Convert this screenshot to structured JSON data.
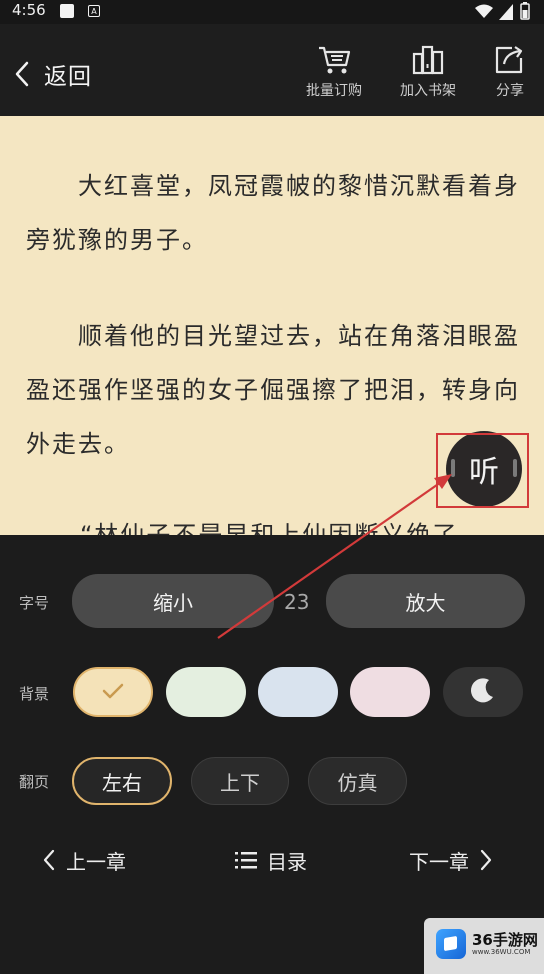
{
  "status_bar": {
    "time": "4:56",
    "notif_icon_text": "A"
  },
  "toolbar": {
    "back_label": "返回",
    "bulk_buy_label": "批量订购",
    "add_shelf_label": "加入书架",
    "share_label": "分享"
  },
  "reader": {
    "paragraphs": [
      "　　大红喜堂，凤冠霞帔的黎惜沉默看着身旁犹豫的男子。",
      "　　顺着他的目光望过去，站在角落泪眼盈盈还强作坚强的女子倔强擦了把泪，转身向外走去。",
      "“林仙子不是早和上仙因断义绝了"
    ],
    "listen_label": "听"
  },
  "settings": {
    "font_size": {
      "label": "字号",
      "decrease": "缩小",
      "value": "23",
      "increase": "放大"
    },
    "background": {
      "label": "背景",
      "swatches": [
        {
          "name": "beige",
          "color": "#f4e2b8",
          "selected": true
        },
        {
          "name": "light-green",
          "color": "#e4efe0",
          "selected": false
        },
        {
          "name": "light-blue",
          "color": "#d9e3ee",
          "selected": false
        },
        {
          "name": "light-pink",
          "color": "#efdde2",
          "selected": false
        },
        {
          "name": "night",
          "color": "#3a3a3a",
          "selected": false
        }
      ]
    },
    "page_turn": {
      "label": "翻页",
      "options": [
        "左右",
        "上下",
        "仿真"
      ],
      "selected": "左右"
    }
  },
  "chapter_nav": {
    "prev": "上一章",
    "toc": "目录",
    "next": "下一章"
  },
  "watermark": {
    "brand": "36手游网",
    "url": "www.36WU.COM"
  },
  "colors": {
    "accent": "#e0b46c",
    "page_bg": "#f4e6c2",
    "panel_bg": "#1c1c1c",
    "annotation": "#d23a3a"
  }
}
